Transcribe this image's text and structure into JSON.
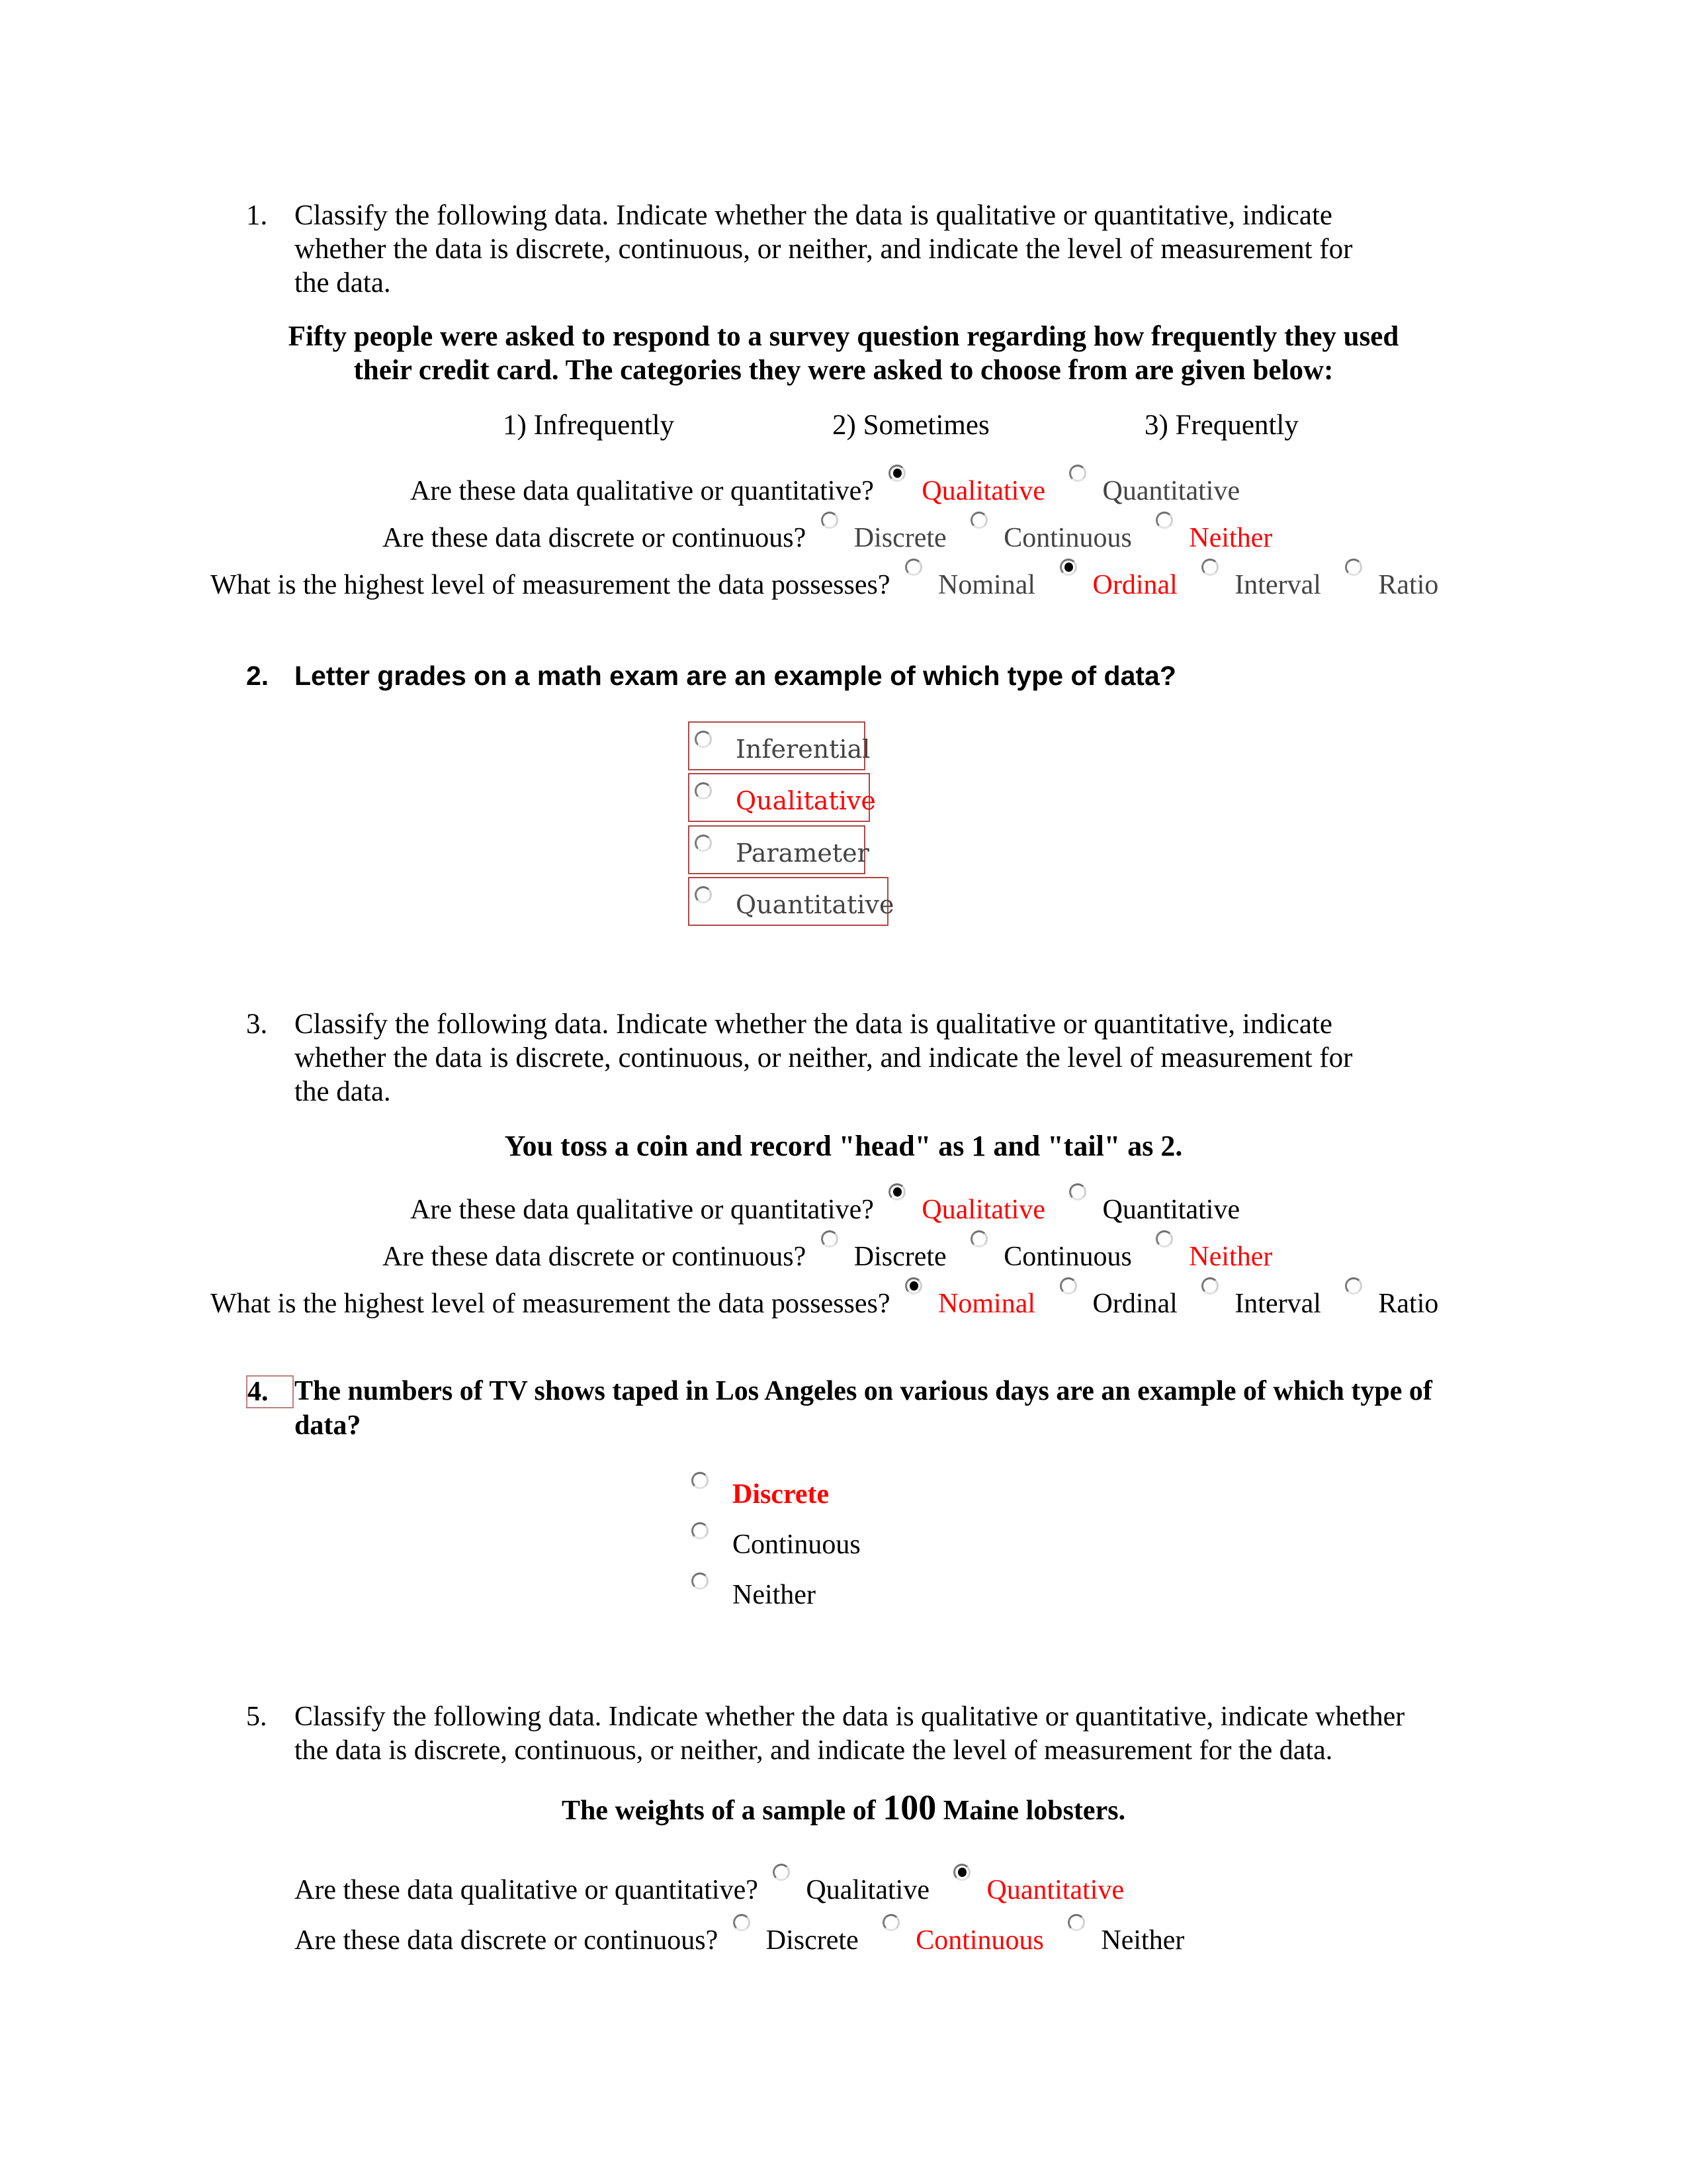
{
  "questions": [
    {
      "number": "1.",
      "instructions_lines": [
        "Classify the following data. Indicate whether the data is qualitative or quantitative, indicate",
        "whether the data is discrete, continuous, or neither, and indicate the level of measurement for",
        "the data."
      ],
      "scenario_lines": [
        "Fifty people were asked to respond to a survey question regarding how frequently they used",
        "their credit card. The categories they were asked to choose from are given below:"
      ],
      "categories": [
        "1) Infrequently",
        "2) Sometimes",
        "3) Frequently"
      ],
      "rows": [
        {
          "prompt": "Are these data qualitative or quantitative?",
          "options": [
            {
              "label": "Qualitative",
              "checked": true,
              "highlight": true
            },
            {
              "label": "Quantitative",
              "checked": false,
              "highlight": false
            }
          ]
        },
        {
          "prompt": "Are these data discrete or continuous?",
          "options": [
            {
              "label": "Discrete",
              "checked": false,
              "highlight": false
            },
            {
              "label": "Continuous",
              "checked": false,
              "highlight": false
            },
            {
              "label": "Neither",
              "checked": false,
              "highlight": true
            }
          ]
        },
        {
          "prompt": "What is the highest level of measurement the data possesses?",
          "options": [
            {
              "label": "Nominal",
              "checked": false,
              "highlight": false
            },
            {
              "label": "Ordinal",
              "checked": true,
              "highlight": true
            },
            {
              "label": "Interval",
              "checked": false,
              "highlight": false
            },
            {
              "label": "Ratio",
              "checked": false,
              "highlight": false
            }
          ]
        }
      ]
    },
    {
      "number": "2.",
      "question": "Letter grades on a math exam are an example of which type of data?",
      "options": [
        {
          "label": "Inferential",
          "checked": false,
          "highlight": false
        },
        {
          "label": "Qualitative",
          "checked": false,
          "highlight": true
        },
        {
          "label": "Parameter",
          "checked": false,
          "highlight": false
        },
        {
          "label": "Quantitative",
          "checked": false,
          "highlight": false
        }
      ]
    },
    {
      "number": "3.",
      "instructions_lines": [
        "Classify the following data. Indicate whether the data is qualitative or quantitative, indicate",
        "whether the data is discrete, continuous, or neither, and indicate the level of measurement for",
        "the data."
      ],
      "scenario": "You toss a coin and record \"head\" as 1 and \"tail\" as 2.",
      "rows": [
        {
          "prompt": "Are these data qualitative or quantitative?",
          "options": [
            {
              "label": "Qualitative",
              "checked": true,
              "highlight": true
            },
            {
              "label": "Quantitative",
              "checked": false,
              "highlight": false
            }
          ]
        },
        {
          "prompt": "Are these data discrete or continuous?",
          "options": [
            {
              "label": "Discrete",
              "checked": false,
              "highlight": false
            },
            {
              "label": "Continuous",
              "checked": false,
              "highlight": false
            },
            {
              "label": "Neither",
              "checked": false,
              "highlight": true
            }
          ]
        },
        {
          "prompt": "What is the highest level of measurement the data possesses?",
          "options": [
            {
              "label": "Nominal",
              "checked": true,
              "highlight": true
            },
            {
              "label": "Ordinal",
              "checked": false,
              "highlight": false
            },
            {
              "label": "Interval",
              "checked": false,
              "highlight": false
            },
            {
              "label": "Ratio",
              "checked": false,
              "highlight": false
            }
          ]
        }
      ]
    },
    {
      "number": "4.",
      "question_lines": [
        "The numbers of TV shows taped in Los Angeles on various days are an example of which type of",
        "data?"
      ],
      "options": [
        {
          "label": "Discrete",
          "checked": false,
          "highlight": true
        },
        {
          "label": "Continuous",
          "checked": false,
          "highlight": false
        },
        {
          "label": "Neither",
          "checked": false,
          "highlight": false
        }
      ]
    },
    {
      "number": "5.",
      "instructions_lines": [
        "Classify the following data. Indicate whether the data is qualitative or quantitative, indicate whether",
        "the data is discrete, continuous, or neither, and indicate the level of measurement for the data."
      ],
      "scenario_parts": [
        "The weights of a sample of ",
        "100",
        " Maine lobsters."
      ],
      "rows": [
        {
          "prompt": "Are these data qualitative or quantitative?",
          "options": [
            {
              "label": "Qualitative",
              "checked": false,
              "highlight": false
            },
            {
              "label": "Quantitative",
              "checked": true,
              "highlight": true
            }
          ]
        },
        {
          "prompt": "Are these data discrete or continuous?",
          "options": [
            {
              "label": "Discrete",
              "checked": false,
              "highlight": false
            },
            {
              "label": "Continuous",
              "checked": false,
              "highlight": true
            },
            {
              "label": "Neither",
              "checked": false,
              "highlight": false
            }
          ]
        }
      ]
    }
  ],
  "colors": {
    "answer_highlight": "#ff0000",
    "box_border": "#b04848"
  }
}
